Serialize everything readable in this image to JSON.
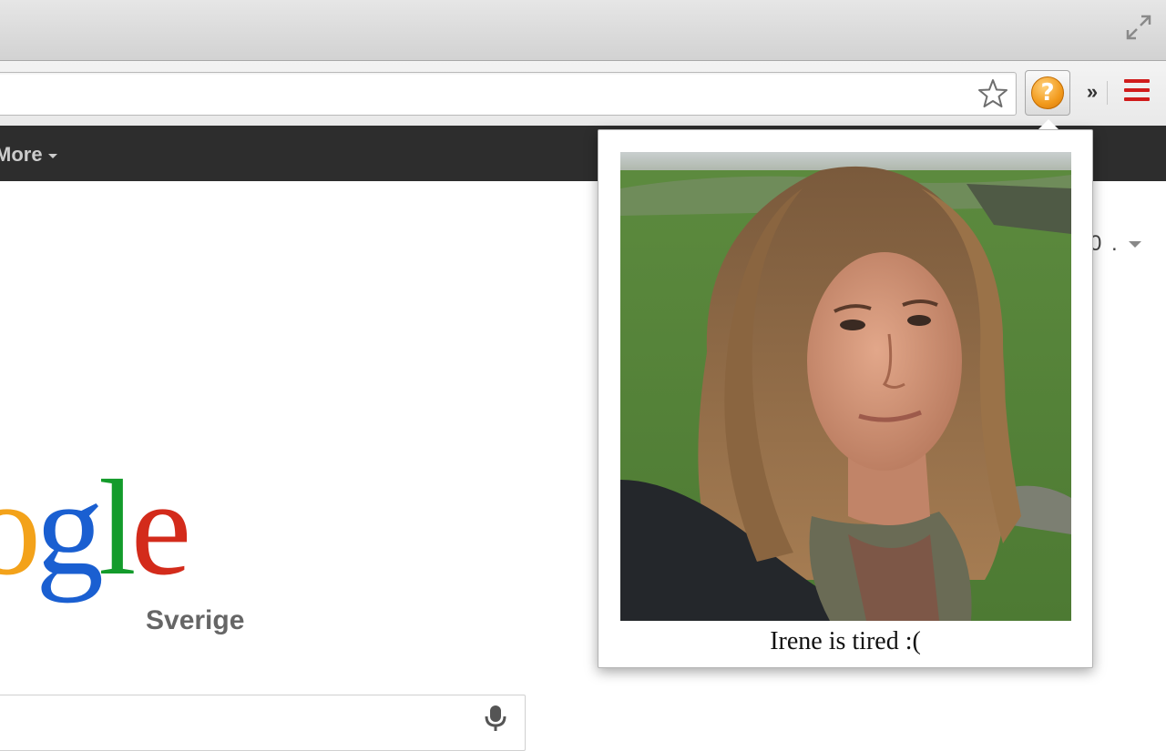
{
  "browser": {
    "fullscreen_icon": "fullscreen-arrows-icon",
    "star_icon": "bookmark-star-icon",
    "extension_icon": "question-mark-icon",
    "extension_symbol": "?",
    "overflow_symbol": "»",
    "menu_icon": "hamburger-menu-icon"
  },
  "gbar": {
    "more_label": "More"
  },
  "logo": {
    "letters": [
      "o",
      "g",
      "l",
      "e"
    ],
    "subtitle": "Sverige"
  },
  "right_partial_text": "0 .",
  "popup": {
    "photo_icon": "portrait-photo",
    "caption": "Irene is tired :("
  },
  "colors": {
    "extension_orange": "#f29a1c",
    "menu_red": "#d01c1c",
    "gbar_black": "#2d2d2d"
  }
}
